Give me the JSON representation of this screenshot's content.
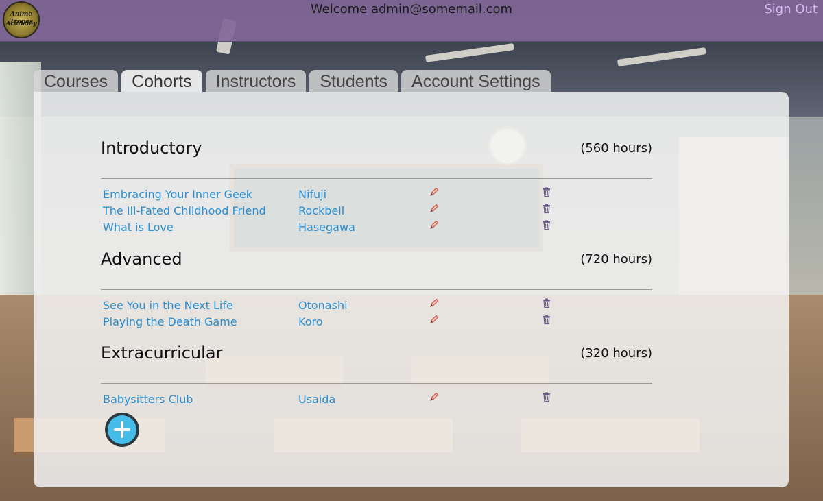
{
  "header": {
    "logo_text_line1": "Anime Tropes",
    "logo_text_line2": "Academy",
    "welcome": "Welcome admin@somemail.com",
    "sign_out_label": "Sign Out"
  },
  "tabs": [
    {
      "label": "Courses",
      "active": false
    },
    {
      "label": "Cohorts",
      "active": true
    },
    {
      "label": "Instructors",
      "active": false
    },
    {
      "label": "Students",
      "active": false
    },
    {
      "label": "Account Settings",
      "active": false
    }
  ],
  "sections": [
    {
      "title": "Introductory",
      "hours": "(560 hours)",
      "cohorts": [
        {
          "name": "Embracing Your Inner Geek",
          "instructor": "Nifuji"
        },
        {
          "name": "The Ill-Fated Childhood Friend",
          "instructor": "Rockbell"
        },
        {
          "name": "What is Love",
          "instructor": "Hasegawa"
        }
      ]
    },
    {
      "title": "Advanced",
      "hours": "(720 hours)",
      "cohorts": [
        {
          "name": "See You in the Next Life",
          "instructor": "Otonashi"
        },
        {
          "name": "Playing the Death Game",
          "instructor": "Koro"
        }
      ]
    },
    {
      "title": "Extracurricular",
      "hours": "(320 hours)",
      "cohorts": [
        {
          "name": "Babysitters Club",
          "instructor": "Usaida"
        }
      ]
    }
  ],
  "icons": {
    "edit": "pencil-icon",
    "delete": "trash-icon",
    "add": "plus-icon"
  },
  "colors": {
    "header_bg": "#81679a",
    "sign_out": "#d6b9f2",
    "link": "#2a8fd4",
    "add_button": "#45bde8",
    "edit_icon": "#e85a5a",
    "delete_icon": "#6b5f8a"
  }
}
